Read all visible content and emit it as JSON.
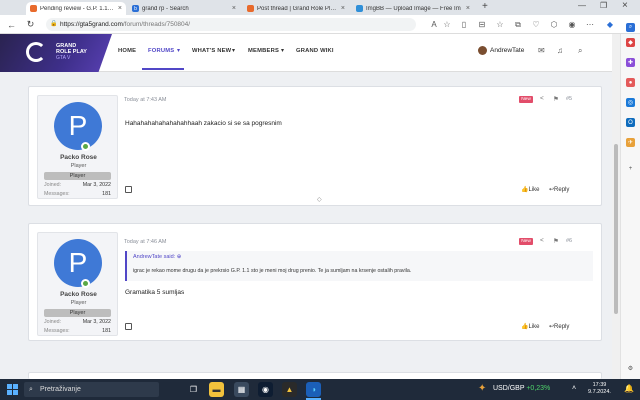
{
  "browser": {
    "tabs": [
      {
        "title": "Pending review - G.P. 1.1, G.P. 1.2",
        "active": true
      },
      {
        "title": "grand rp - Search",
        "active": false
      },
      {
        "title": "Post thread | Grand Role Play | For",
        "active": false
      },
      {
        "title": "ImgBB — Upload Image — Free Im",
        "active": false
      }
    ],
    "new_tab_glyph": "+",
    "url_host": "https://gta5grand.com",
    "url_path": "/forum/threads/750804/"
  },
  "site": {
    "logo_line1": "GRAND",
    "logo_line2": "ROLE PLAY",
    "logo_line3": "GTA V",
    "nav": [
      {
        "label": "HOME"
      },
      {
        "label": "FORUMS"
      },
      {
        "label": "WHAT'S NEW"
      },
      {
        "label": "MEMBERS"
      },
      {
        "label": "GRAND WIKI"
      }
    ],
    "username": "AndrewTate",
    "accent": "#5147c7"
  },
  "posts": [
    {
      "avatar_letter": "P",
      "author": "Packo Rose",
      "user_title": "Player",
      "badge": "Player",
      "joined_label": "Joined:",
      "joined_value": "Mar 3, 2022",
      "messages_label": "Messages:",
      "messages_value": "181",
      "time": "Today at 7:43 AM",
      "new_badge": "New",
      "number": "#5",
      "body": "Hahahahahahahahahhaah zakacio si se sa pogresnim",
      "like": "Like",
      "reply": "Reply"
    },
    {
      "avatar_letter": "P",
      "author": "Packo Rose",
      "user_title": "Player",
      "badge": "Player",
      "joined_label": "Joined:",
      "joined_value": "Mar 3, 2022",
      "messages_label": "Messages:",
      "messages_value": "181",
      "time": "Today at 7:46 AM",
      "new_badge": "New",
      "number": "#6",
      "quote_author": "AndrewTate said:",
      "quote_text": "igrac je rekao mome drugu da je prekrsio G.P. 1.1 sto je meni moj drug prenio. Te ja sumljam na krsenje ostalih pravila.",
      "body": "Gramatika 5 sumljas",
      "like": "Like",
      "reply": "Reply"
    }
  ],
  "taskbar": {
    "search_placeholder": "Pretraživanje",
    "forex_pair": "USD/GBP",
    "forex_change": "+0,23%",
    "time": "17:39",
    "date": "9.7.2024."
  }
}
